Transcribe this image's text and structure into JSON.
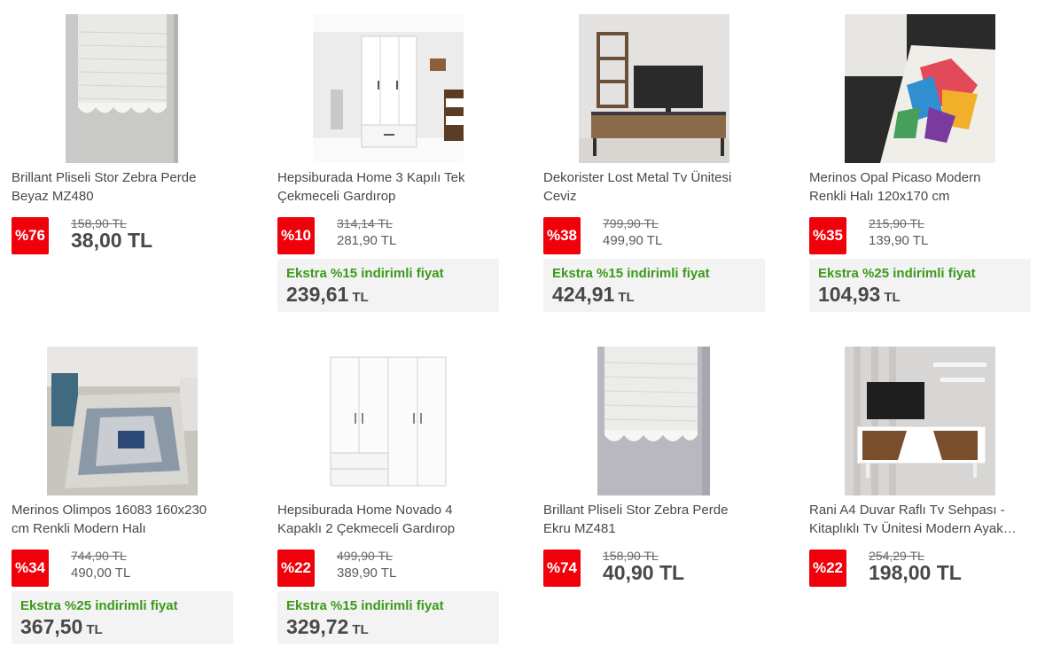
{
  "products": [
    {
      "title_lines": [
        "Brillant Pliseli Stor Zebra Perde",
        "Beyaz MZ480"
      ],
      "discount": "%76",
      "old_price": "158,90 TL",
      "price": "38,00 TL",
      "image": "white-pleated-blind-icon"
    },
    {
      "title_lines": [
        "Hepsiburada Home 3 Kapılı Tek",
        "Çekmeceli Gardırop"
      ],
      "discount": "%10",
      "old_price": "314,14 TL",
      "price": "281,90 TL",
      "extra_pre": "Ekstra ",
      "extra_pct": "%15",
      "extra_post": " indirimli fiyat",
      "extra_amount": "239,61",
      "extra_currency": "TL",
      "image": "white-wardrobe-icon"
    },
    {
      "title_lines": [
        "Dekorister Lost Metal Tv Ünitesi",
        "Ceviz"
      ],
      "discount": "%38",
      "old_price": "799,90 TL",
      "price": "499,90 TL",
      "extra_pre": "Ekstra ",
      "extra_pct": "%15",
      "extra_post": " indirimli fiyat",
      "extra_amount": "424,91",
      "extra_currency": "TL",
      "image": "tv-unit-icon"
    },
    {
      "title_lines": [
        "Merinos Opal Picaso Modern",
        "Renkli Halı 120x170 cm"
      ],
      "discount": "%35",
      "old_price": "215,90 TL",
      "price": "139,90 TL",
      "extra_pre": "Ekstra ",
      "extra_pct": "%25",
      "extra_post": " indirimli fiyat",
      "extra_amount": "104,93",
      "extra_currency": "TL",
      "image": "colorful-rug-icon"
    },
    {
      "title_lines": [
        "Merinos Olimpos 16083 160x230",
        "cm Renkli Modern Halı"
      ],
      "discount": "%34",
      "old_price": "744,90 TL",
      "price": "490,00 TL",
      "extra_pre": "Ekstra ",
      "extra_pct": "%25",
      "extra_post": " indirimli fiyat",
      "extra_amount": "367,50",
      "extra_currency": "TL",
      "image": "grey-rug-icon"
    },
    {
      "title_lines": [
        "Hepsiburada Home Novado 4",
        "Kapaklı 2 Çekmeceli Gardırop"
      ],
      "discount": "%22",
      "old_price": "499,90 TL",
      "price": "389,90 TL",
      "extra_pre": "Ekstra ",
      "extra_pct": "%15",
      "extra_post": " indirimli fiyat",
      "extra_amount": "329,72",
      "extra_currency": "TL",
      "image": "four-door-wardrobe-icon"
    },
    {
      "title_lines": [
        "Brillant Pliseli Stor Zebra Perde",
        "Ekru MZ481"
      ],
      "discount": "%74",
      "old_price": "158,90 TL",
      "price": "40,90 TL",
      "image": "ecru-pleated-blind-icon"
    },
    {
      "title_lines": [
        "Rani A4 Duvar Raflı Tv Sehpası -",
        "Kitaplıklı Tv Ünitesi Modern Ayak…"
      ],
      "discount": "%22",
      "old_price": "254,29 TL",
      "price": "198,00 TL",
      "image": "tv-stand-shelves-icon"
    }
  ],
  "colors": {
    "badge": "#f0000b",
    "extra_label": "#3b9a1a",
    "extra_bg": "#f3f3f3"
  }
}
